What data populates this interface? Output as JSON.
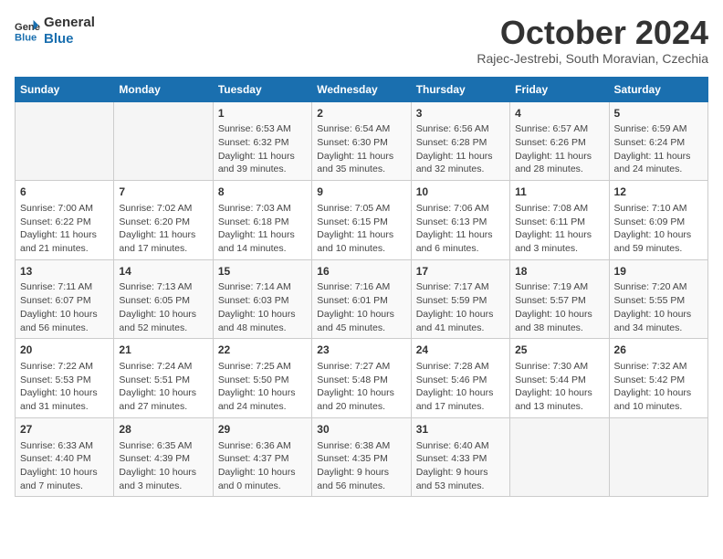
{
  "logo": {
    "line1": "General",
    "line2": "Blue"
  },
  "title": "October 2024",
  "subtitle": "Rajec-Jestrebi, South Moravian, Czechia",
  "days_header": [
    "Sunday",
    "Monday",
    "Tuesday",
    "Wednesday",
    "Thursday",
    "Friday",
    "Saturday"
  ],
  "weeks": [
    [
      {
        "day": "",
        "info": ""
      },
      {
        "day": "",
        "info": ""
      },
      {
        "day": "1",
        "info": "Sunrise: 6:53 AM\nSunset: 6:32 PM\nDaylight: 11 hours and 39 minutes."
      },
      {
        "day": "2",
        "info": "Sunrise: 6:54 AM\nSunset: 6:30 PM\nDaylight: 11 hours and 35 minutes."
      },
      {
        "day": "3",
        "info": "Sunrise: 6:56 AM\nSunset: 6:28 PM\nDaylight: 11 hours and 32 minutes."
      },
      {
        "day": "4",
        "info": "Sunrise: 6:57 AM\nSunset: 6:26 PM\nDaylight: 11 hours and 28 minutes."
      },
      {
        "day": "5",
        "info": "Sunrise: 6:59 AM\nSunset: 6:24 PM\nDaylight: 11 hours and 24 minutes."
      }
    ],
    [
      {
        "day": "6",
        "info": "Sunrise: 7:00 AM\nSunset: 6:22 PM\nDaylight: 11 hours and 21 minutes."
      },
      {
        "day": "7",
        "info": "Sunrise: 7:02 AM\nSunset: 6:20 PM\nDaylight: 11 hours and 17 minutes."
      },
      {
        "day": "8",
        "info": "Sunrise: 7:03 AM\nSunset: 6:18 PM\nDaylight: 11 hours and 14 minutes."
      },
      {
        "day": "9",
        "info": "Sunrise: 7:05 AM\nSunset: 6:15 PM\nDaylight: 11 hours and 10 minutes."
      },
      {
        "day": "10",
        "info": "Sunrise: 7:06 AM\nSunset: 6:13 PM\nDaylight: 11 hours and 6 minutes."
      },
      {
        "day": "11",
        "info": "Sunrise: 7:08 AM\nSunset: 6:11 PM\nDaylight: 11 hours and 3 minutes."
      },
      {
        "day": "12",
        "info": "Sunrise: 7:10 AM\nSunset: 6:09 PM\nDaylight: 10 hours and 59 minutes."
      }
    ],
    [
      {
        "day": "13",
        "info": "Sunrise: 7:11 AM\nSunset: 6:07 PM\nDaylight: 10 hours and 56 minutes."
      },
      {
        "day": "14",
        "info": "Sunrise: 7:13 AM\nSunset: 6:05 PM\nDaylight: 10 hours and 52 minutes."
      },
      {
        "day": "15",
        "info": "Sunrise: 7:14 AM\nSunset: 6:03 PM\nDaylight: 10 hours and 48 minutes."
      },
      {
        "day": "16",
        "info": "Sunrise: 7:16 AM\nSunset: 6:01 PM\nDaylight: 10 hours and 45 minutes."
      },
      {
        "day": "17",
        "info": "Sunrise: 7:17 AM\nSunset: 5:59 PM\nDaylight: 10 hours and 41 minutes."
      },
      {
        "day": "18",
        "info": "Sunrise: 7:19 AM\nSunset: 5:57 PM\nDaylight: 10 hours and 38 minutes."
      },
      {
        "day": "19",
        "info": "Sunrise: 7:20 AM\nSunset: 5:55 PM\nDaylight: 10 hours and 34 minutes."
      }
    ],
    [
      {
        "day": "20",
        "info": "Sunrise: 7:22 AM\nSunset: 5:53 PM\nDaylight: 10 hours and 31 minutes."
      },
      {
        "day": "21",
        "info": "Sunrise: 7:24 AM\nSunset: 5:51 PM\nDaylight: 10 hours and 27 minutes."
      },
      {
        "day": "22",
        "info": "Sunrise: 7:25 AM\nSunset: 5:50 PM\nDaylight: 10 hours and 24 minutes."
      },
      {
        "day": "23",
        "info": "Sunrise: 7:27 AM\nSunset: 5:48 PM\nDaylight: 10 hours and 20 minutes."
      },
      {
        "day": "24",
        "info": "Sunrise: 7:28 AM\nSunset: 5:46 PM\nDaylight: 10 hours and 17 minutes."
      },
      {
        "day": "25",
        "info": "Sunrise: 7:30 AM\nSunset: 5:44 PM\nDaylight: 10 hours and 13 minutes."
      },
      {
        "day": "26",
        "info": "Sunrise: 7:32 AM\nSunset: 5:42 PM\nDaylight: 10 hours and 10 minutes."
      }
    ],
    [
      {
        "day": "27",
        "info": "Sunrise: 6:33 AM\nSunset: 4:40 PM\nDaylight: 10 hours and 7 minutes."
      },
      {
        "day": "28",
        "info": "Sunrise: 6:35 AM\nSunset: 4:39 PM\nDaylight: 10 hours and 3 minutes."
      },
      {
        "day": "29",
        "info": "Sunrise: 6:36 AM\nSunset: 4:37 PM\nDaylight: 10 hours and 0 minutes."
      },
      {
        "day": "30",
        "info": "Sunrise: 6:38 AM\nSunset: 4:35 PM\nDaylight: 9 hours and 56 minutes."
      },
      {
        "day": "31",
        "info": "Sunrise: 6:40 AM\nSunset: 4:33 PM\nDaylight: 9 hours and 53 minutes."
      },
      {
        "day": "",
        "info": ""
      },
      {
        "day": "",
        "info": ""
      }
    ]
  ]
}
